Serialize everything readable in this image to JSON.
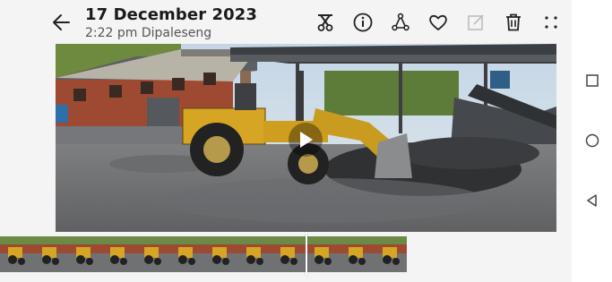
{
  "header": {
    "date": "17 December 2023",
    "time_location": "2:22 pm Dipaleseng"
  },
  "icons": {
    "back": "back-arrow-icon",
    "toolbar": [
      "edit-scissors-icon",
      "info-icon",
      "share-icon",
      "favorite-heart-icon",
      "markup-icon",
      "delete-icon",
      "more-icon"
    ],
    "play": "play-icon",
    "nav": [
      "recents-square-icon",
      "home-circle-icon",
      "back-triangle-icon"
    ]
  },
  "video": {
    "scene": "yellow backhoe loader at coal yard"
  },
  "filmstrip": {
    "playhead_fraction": 0.75
  }
}
